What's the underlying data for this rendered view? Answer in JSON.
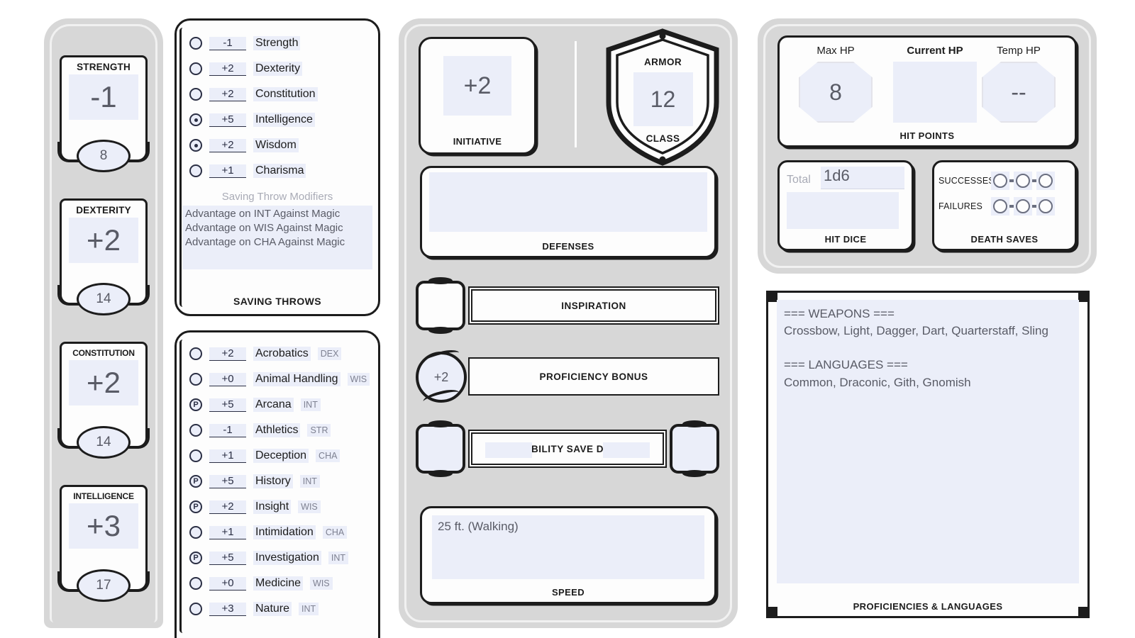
{
  "abilities": [
    {
      "name": "STRENGTH",
      "modifier": "-1",
      "score": "8"
    },
    {
      "name": "DEXTERITY",
      "modifier": "+2",
      "score": "14"
    },
    {
      "name": "CONSTITUTION",
      "modifier": "+2",
      "score": "14"
    },
    {
      "name": "INTELLIGENCE",
      "modifier": "+3",
      "score": "17"
    }
  ],
  "saving_throws": {
    "caption": "SAVING THROWS",
    "modifiers_title": "Saving Throw Modifiers",
    "modifiers_text": "Advantage on INT Against Magic\nAdvantage on WIS Against Magic\nAdvantage on CHA Against Magic",
    "rows": [
      {
        "state": "empty",
        "mod": "-1",
        "label": "Strength"
      },
      {
        "state": "empty",
        "mod": "+2",
        "label": "Dexterity"
      },
      {
        "state": "empty",
        "mod": "+2",
        "label": "Constitution"
      },
      {
        "state": "dot",
        "mod": "+5",
        "label": "Intelligence"
      },
      {
        "state": "dot",
        "mod": "+2",
        "label": "Wisdom"
      },
      {
        "state": "empty",
        "mod": "+1",
        "label": "Charisma"
      }
    ]
  },
  "skills": {
    "rows": [
      {
        "state": "empty",
        "mod": "+2",
        "label": "Acrobatics",
        "abbr": "DEX"
      },
      {
        "state": "empty",
        "mod": "+0",
        "label": "Animal Handling",
        "abbr": "WIS"
      },
      {
        "state": "prof",
        "mod": "+5",
        "label": "Arcana",
        "abbr": "INT"
      },
      {
        "state": "empty",
        "mod": "-1",
        "label": "Athletics",
        "abbr": "STR"
      },
      {
        "state": "empty",
        "mod": "+1",
        "label": "Deception",
        "abbr": "CHA"
      },
      {
        "state": "prof",
        "mod": "+5",
        "label": "History",
        "abbr": "INT"
      },
      {
        "state": "prof",
        "mod": "+2",
        "label": "Insight",
        "abbr": "WIS"
      },
      {
        "state": "empty",
        "mod": "+1",
        "label": "Intimidation",
        "abbr": "CHA"
      },
      {
        "state": "prof",
        "mod": "+5",
        "label": "Investigation",
        "abbr": "INT"
      },
      {
        "state": "empty",
        "mod": "+0",
        "label": "Medicine",
        "abbr": "WIS"
      },
      {
        "state": "empty",
        "mod": "+3",
        "label": "Nature",
        "abbr": "INT"
      }
    ]
  },
  "initiative": {
    "value": "+2",
    "caption": "INITIATIVE"
  },
  "armor_class": {
    "label_top": "ARMOR",
    "label_bottom": "CLASS",
    "value": "12"
  },
  "defenses": {
    "caption": "DEFENSES",
    "value": ""
  },
  "inspiration": {
    "caption": "INSPIRATION",
    "value": ""
  },
  "proficiency_bonus": {
    "caption": "PROFICIENCY BONUS",
    "value": "+2"
  },
  "ability_save_dc": {
    "caption": "ABILITY SAVE DC",
    "left_value": "",
    "right_value": ""
  },
  "speed": {
    "caption": "SPEED",
    "value": "25 ft. (Walking)"
  },
  "hit_points": {
    "caption": "HIT POINTS",
    "max_label": "Max HP",
    "max_value": "8",
    "current_label": "Current HP",
    "current_value": "",
    "temp_label": "Temp HP",
    "temp_value": "--"
  },
  "hit_dice": {
    "caption": "HIT DICE",
    "total_label": "Total",
    "total_value": "1d6",
    "field_value": ""
  },
  "death_saves": {
    "caption": "DEATH SAVES",
    "successes_label": "SUCCESSES",
    "failures_label": "FAILURES",
    "successes": [
      false,
      false,
      false
    ],
    "failures": [
      false,
      false,
      false
    ]
  },
  "proficiencies": {
    "caption": "PROFICIENCIES & LANGUAGES",
    "text": "=== WEAPONS ===\nCrossbow, Light, Dagger, Dart, Quarterstaff, Sling\n\n=== LANGUAGES ===\nCommon, Draconic, Gith, Gnomish"
  },
  "colors": {
    "panel_gray": "#d7d7d7",
    "field_fill": "#ebeef9",
    "ink": "#1c1c1c",
    "value_text": "#595b66"
  }
}
